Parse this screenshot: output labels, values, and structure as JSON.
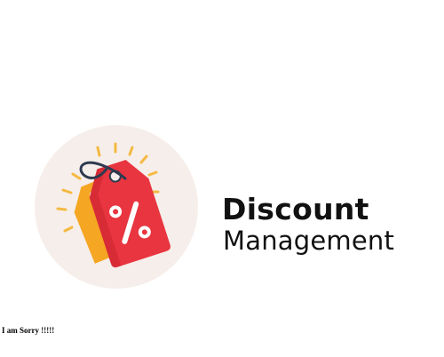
{
  "logo": {
    "icon": "discount-tag-icon",
    "symbol": "%",
    "colors": {
      "circle_background": "#F6EEEA",
      "front_tag": "#E8353F",
      "back_tag": "#F5A623",
      "tag_string": "#2E3A4F",
      "sparks": "#F4B942"
    }
  },
  "brand": {
    "title_bold": "Discount",
    "title_light": "Management"
  },
  "footnote": {
    "text": "I am Sorry !!!!!"
  }
}
